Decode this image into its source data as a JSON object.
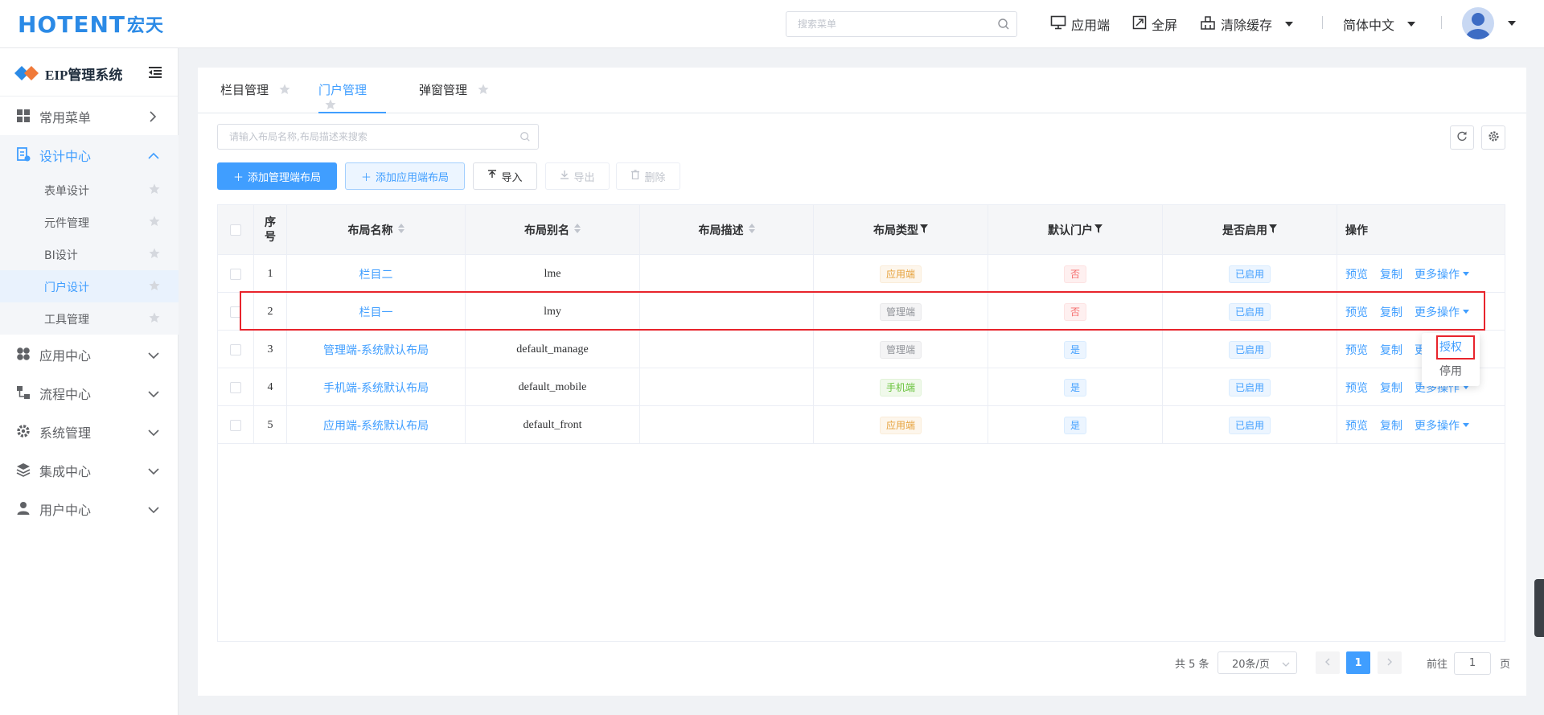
{
  "app": {
    "logo_text": "HOTENT",
    "logo_zh": "宏天",
    "search_placeholder": "搜索菜单",
    "top_actions": [
      "应用端",
      "全屏",
      "清除缓存"
    ],
    "language": "简体中文"
  },
  "sidebar": {
    "system_title": "EIP管理系统",
    "menus": [
      {
        "label": "常用菜单",
        "icon": "grid-icon"
      },
      {
        "label": "设计中心",
        "icon": "design-icon",
        "expanded": true,
        "children": [
          "表单设计",
          "元件管理",
          "BI设计",
          "门户设计",
          "工具管理"
        ],
        "current": "门户设计"
      },
      {
        "label": "应用中心",
        "icon": "apps-icon"
      },
      {
        "label": "流程中心",
        "icon": "flow-icon"
      },
      {
        "label": "系统管理",
        "icon": "gear-icon"
      },
      {
        "label": "集成中心",
        "icon": "layers-icon"
      },
      {
        "label": "用户中心",
        "icon": "user-icon"
      }
    ]
  },
  "tabs": [
    "栏目管理",
    "门户管理",
    "弹窗管理"
  ],
  "active_tab": "门户管理",
  "search": {
    "placeholder": "请输入布局名称,布局描述来搜索"
  },
  "buttons": {
    "add_manage": "添加管理端布局",
    "add_app": "添加应用端布局",
    "import": "导入",
    "export": "导出",
    "delete": "删除"
  },
  "table": {
    "headers": {
      "index": "序号",
      "name": "布局名称",
      "alias": "布局别名",
      "desc": "布局描述",
      "type": "布局类型",
      "default": "默认门户",
      "enabled": "是否启用",
      "ops": "操作"
    },
    "rows": [
      {
        "index": "1",
        "name": "栏目二",
        "alias": "lme",
        "desc": "",
        "type": "应用端",
        "type_color": "orange",
        "default": "否",
        "default_color": "red",
        "enabled": "已启用"
      },
      {
        "index": "2",
        "name": "栏目一",
        "alias": "lmy",
        "desc": "",
        "type": "管理端",
        "type_color": "gray",
        "default": "否",
        "default_color": "red",
        "enabled": "已启用"
      },
      {
        "index": "3",
        "name": "管理端-系统默认布局",
        "alias": "default_manage",
        "desc": "",
        "type": "管理端",
        "type_color": "gray",
        "default": "是",
        "default_color": "blue",
        "enabled": "已启用"
      },
      {
        "index": "4",
        "name": "手机端-系统默认布局",
        "alias": "default_mobile",
        "desc": "",
        "type": "手机端",
        "type_color": "green",
        "default": "是",
        "default_color": "blue",
        "enabled": "已启用"
      },
      {
        "index": "5",
        "name": "应用端-系统默认布局",
        "alias": "default_front",
        "desc": "",
        "type": "应用端",
        "type_color": "orange",
        "default": "是",
        "default_color": "blue",
        "enabled": "已启用"
      }
    ],
    "row_actions": {
      "preview": "预览",
      "copy": "复制",
      "more": "更多操作"
    }
  },
  "more_menu": {
    "authorize": "授权",
    "disable": "停用"
  },
  "pagination": {
    "total": "共 5 条",
    "page_size": "20条/页",
    "current_page": "1",
    "goto_prefix": "前往",
    "goto_value": "1",
    "goto_suffix": "页"
  },
  "colors": {
    "primary": "#409eff",
    "highlight": "#e8242c"
  }
}
